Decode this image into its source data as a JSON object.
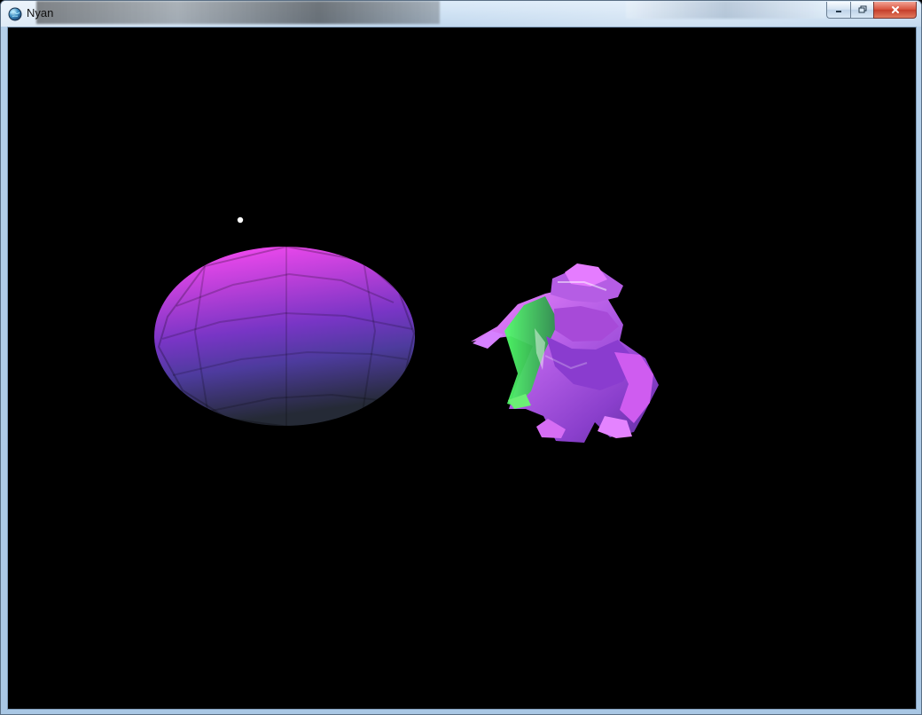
{
  "window": {
    "title": "Nyan",
    "icon": "globe-app-icon"
  },
  "caption_buttons": {
    "minimize_icon": "minimize-icon",
    "restore_icon": "restore-icon",
    "close_icon": "close-icon"
  },
  "scene": {
    "background_color": "#000000",
    "sphere_colors": [
      "#ff47f2",
      "#b53ed6",
      "#7a35c5",
      "#543ba7",
      "#2b3044"
    ],
    "character_colors": [
      "#d25ae6",
      "#a54cd8",
      "#48d94f",
      "#f084ff",
      "#ffffff"
    ],
    "particle_color": "#ffffff"
  }
}
